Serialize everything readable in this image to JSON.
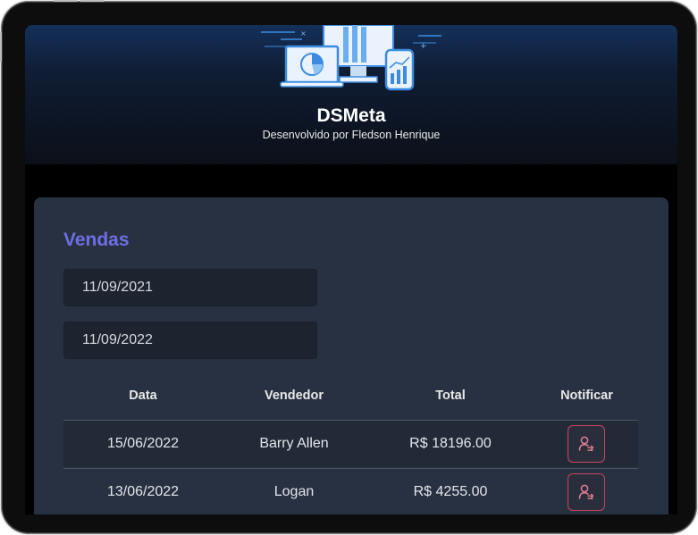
{
  "header": {
    "title": "DSMeta",
    "subtitle": "Desenvolvido por Fledson Henrique",
    "logo_icon": "dashboard-devices-illustration"
  },
  "sales": {
    "title": "Vendas",
    "min_date": "11/09/2021",
    "max_date": "11/09/2022",
    "columns": [
      "Data",
      "Vendedor",
      "Total",
      "Notificar"
    ],
    "rows": [
      {
        "date": "15/06/2022",
        "seller": "Barry Allen",
        "total": "R$ 18196.00",
        "notify_icon": "notification-user-icon"
      },
      {
        "date": "13/06/2022",
        "seller": "Logan",
        "total": "R$ 4255.00",
        "notify_icon": "notification-user-icon"
      }
    ]
  },
  "colors": {
    "accent": "#6d6fe3",
    "card": "#283142",
    "notify_border": "#c7465e",
    "header_top": "#14305a"
  }
}
